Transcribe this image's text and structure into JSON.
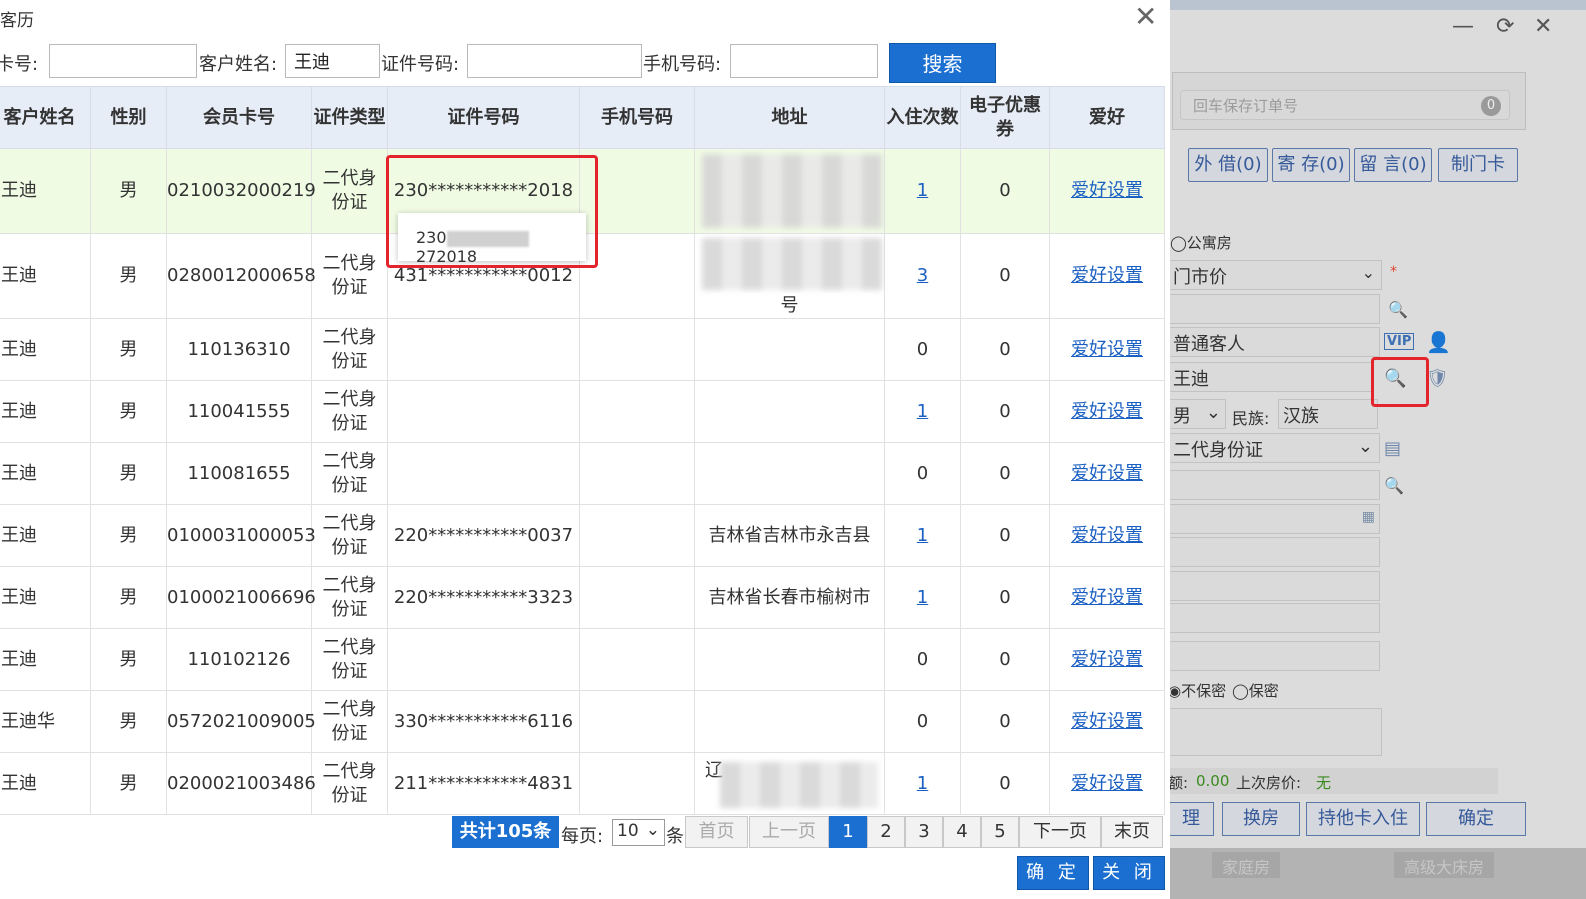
{
  "dialog": {
    "title": "客历",
    "close_glyph": "✕",
    "search": {
      "card_label": "卡号:",
      "card_value": "",
      "name_label": "客户姓名:",
      "name_value": "王迪",
      "id_label": "证件号码:",
      "id_value": "",
      "phone_label": "手机号码:",
      "phone_value": "",
      "search_button": "搜索"
    },
    "table": {
      "headers": [
        "客户姓名",
        "性别",
        "会员卡号",
        "证件类型",
        "证件号码",
        "手机号码",
        "地址",
        "入住次数",
        "电子优惠券",
        "爱好"
      ],
      "rows": [
        {
          "name": "王迪",
          "gender": "男",
          "card": "0210032000219",
          "id_type": "二代身份证",
          "id_no": "230***********2018",
          "phone": "",
          "address": "",
          "stays": "1",
          "coupons": "0",
          "hobby": "爱好设置"
        },
        {
          "name": "王迪",
          "gender": "男",
          "card": "0280012000658",
          "id_type": "二代身份证",
          "id_no": "431***********0012",
          "phone": "",
          "address": "号",
          "stays": "3",
          "coupons": "0",
          "hobby": "爱好设置"
        },
        {
          "name": "王迪",
          "gender": "男",
          "card": "110136310",
          "id_type": "二代身份证",
          "id_no": "",
          "phone": "",
          "address": "",
          "stays": "0",
          "coupons": "0",
          "hobby": "爱好设置"
        },
        {
          "name": "王迪",
          "gender": "男",
          "card": "110041555",
          "id_type": "二代身份证",
          "id_no": "",
          "phone": "",
          "address": "",
          "stays": "1",
          "coupons": "0",
          "hobby": "爱好设置"
        },
        {
          "name": "王迪",
          "gender": "男",
          "card": "110081655",
          "id_type": "二代身份证",
          "id_no": "",
          "phone": "",
          "address": "",
          "stays": "0",
          "coupons": "0",
          "hobby": "爱好设置"
        },
        {
          "name": "王迪",
          "gender": "男",
          "card": "0100031000053",
          "id_type": "二代身份证",
          "id_no": "220***********0037",
          "phone": "",
          "address": "吉林省吉林市永吉县",
          "stays": "1",
          "coupons": "0",
          "hobby": "爱好设置"
        },
        {
          "name": "王迪",
          "gender": "男",
          "card": "0100021006696",
          "id_type": "二代身份证",
          "id_no": "220***********3323",
          "phone": "",
          "address": "吉林省长春市榆树市",
          "stays": "1",
          "coupons": "0",
          "hobby": "爱好设置"
        },
        {
          "name": "王迪",
          "gender": "男",
          "card": "110102126",
          "id_type": "二代身份证",
          "id_no": "",
          "phone": "",
          "address": "",
          "stays": "0",
          "coupons": "0",
          "hobby": "爱好设置"
        },
        {
          "name": "王迪华",
          "gender": "男",
          "card": "0572021009005",
          "id_type": "二代身份证",
          "id_no": "330***********6116",
          "phone": "",
          "address": "",
          "stays": "0",
          "coupons": "0",
          "hobby": "爱好设置"
        },
        {
          "name": "王迪",
          "gender": "男",
          "card": "0200021003486",
          "id_type": "二代身份证",
          "id_no": "211***********4831",
          "phone": "",
          "address": "辽",
          "stays": "1",
          "coupons": "0",
          "hobby": "爱好设置"
        }
      ]
    },
    "popup": {
      "prefix": "230",
      "suffix": "272018"
    },
    "pager": {
      "total": "共计105条",
      "per_page_label": "每页:",
      "per_page_value": "10",
      "unit": "条",
      "first": "首页",
      "prev": "上一页",
      "pages": [
        "1",
        "2",
        "3",
        "4",
        "5"
      ],
      "current_page": "1",
      "next": "下一页",
      "last": "末页"
    },
    "confirm_button": "确 定",
    "close_button": "关 闭"
  },
  "background_window": {
    "minimize_glyph": "—",
    "refresh_glyph": "⟳",
    "close_glyph": "✕",
    "order_placeholder": "回车保存订单号",
    "order_count": "0",
    "buttons": [
      "外 借(0)",
      "寄 存(0)",
      "留 言(0)",
      "制门卡"
    ],
    "apartment_label": "公寓房",
    "price_type": "门市价",
    "guest_type": "普通客人",
    "vip_badge": "VIP",
    "guest_name": "王迪",
    "gender": "男",
    "ethnicity_label": "民族:",
    "ethnicity": "汉族",
    "id_type": "二代身份证",
    "privacy_no": "不保密",
    "privacy_yes": "保密",
    "balance_label": "额:",
    "balance": "0.00",
    "last_price_label": "上次房价:",
    "last_price": "无",
    "bottom_buttons": [
      "理",
      "换房",
      "持他卡入住",
      "确定"
    ],
    "room_types": [
      "家庭房",
      "高级大床房"
    ],
    "required_mark": "*"
  }
}
